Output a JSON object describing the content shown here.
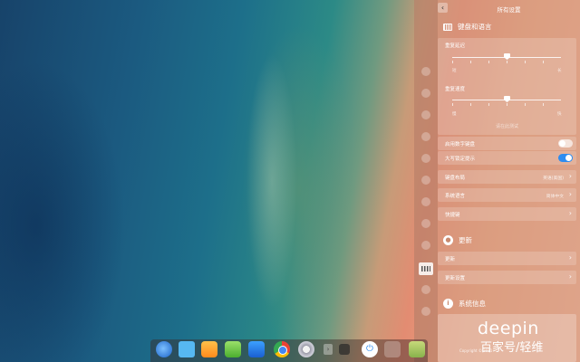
{
  "panel": {
    "title": "所有设置",
    "back_icon": "chevron-left-icon",
    "sidebar_icons": [
      "user-icon",
      "cloud-icon",
      "display-icon",
      "calendar-icon",
      "personalization-icon",
      "network-icon",
      "sound-icon",
      "time-icon",
      "power-icon",
      "mouse-icon",
      "keyboard-icon",
      "update-icon",
      "info-icon"
    ]
  },
  "keyboard": {
    "heading": "键盘和语言",
    "repeat_delay": {
      "label": "重复延迟",
      "min": "短",
      "max": "长",
      "level": 0.5
    },
    "repeat_rate": {
      "label": "重复速度",
      "min": "慢",
      "max": "快",
      "level": 0.5
    },
    "test_placeholder": "请在此测试",
    "numlock": {
      "label": "启用数字键盘",
      "on": false
    },
    "capslock": {
      "label": "大写锁定提示",
      "on": true
    },
    "layout": {
      "label": "键盘布局",
      "value": "英语(美国)"
    },
    "language": {
      "label": "系统语言",
      "value": "简体中文"
    },
    "shortcuts": {
      "label": "快捷键"
    }
  },
  "update": {
    "heading": "更新",
    "rows": [
      {
        "label": "更新"
      },
      {
        "label": "更新设置"
      }
    ]
  },
  "sysinfo": {
    "heading": "系统信息",
    "logo": "deepin",
    "copyright": "Copyright © 2011"
  },
  "watermark": "百家号/轻维",
  "dock": [
    "launcher",
    "files",
    "store",
    "music",
    "video",
    "chrome",
    "settings",
    "arrow",
    "small",
    "power",
    "gray",
    "tray"
  ]
}
